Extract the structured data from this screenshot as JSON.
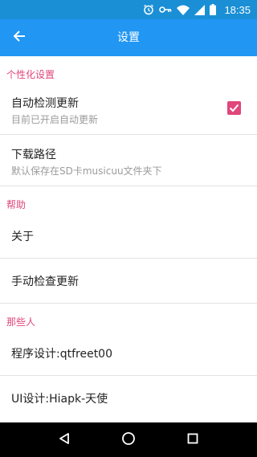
{
  "status_bar": {
    "time": "18:35",
    "icons": [
      "alarm-icon",
      "key-icon",
      "wifi-icon",
      "signal-icon",
      "battery-icon"
    ]
  },
  "toolbar": {
    "title": "设置",
    "back_icon": "arrow-back-icon"
  },
  "colors": {
    "status_bar": "#1a8fd6",
    "toolbar": "#2196f3",
    "accent": "#e0457b"
  },
  "sections": {
    "personal": {
      "header": "个性化设置",
      "auto_update": {
        "title": "自动检测更新",
        "subtitle": "目前已开启自动更新",
        "checked": true
      },
      "download_path": {
        "title": "下载路径",
        "subtitle": "默认保存在SD卡musicuu文件夹下"
      }
    },
    "help": {
      "header": "帮助",
      "about": {
        "title": "关于"
      },
      "manual_update": {
        "title": "手动检查更新"
      }
    },
    "people": {
      "header": "那些人",
      "programmer": {
        "title": "程序设计:qtfreet00"
      },
      "ui_designer": {
        "title": "UI设计:Hiapk-天使"
      }
    }
  },
  "nav_bar": {
    "icons": [
      "back-triangle-icon",
      "home-circle-icon",
      "recents-square-icon"
    ]
  }
}
